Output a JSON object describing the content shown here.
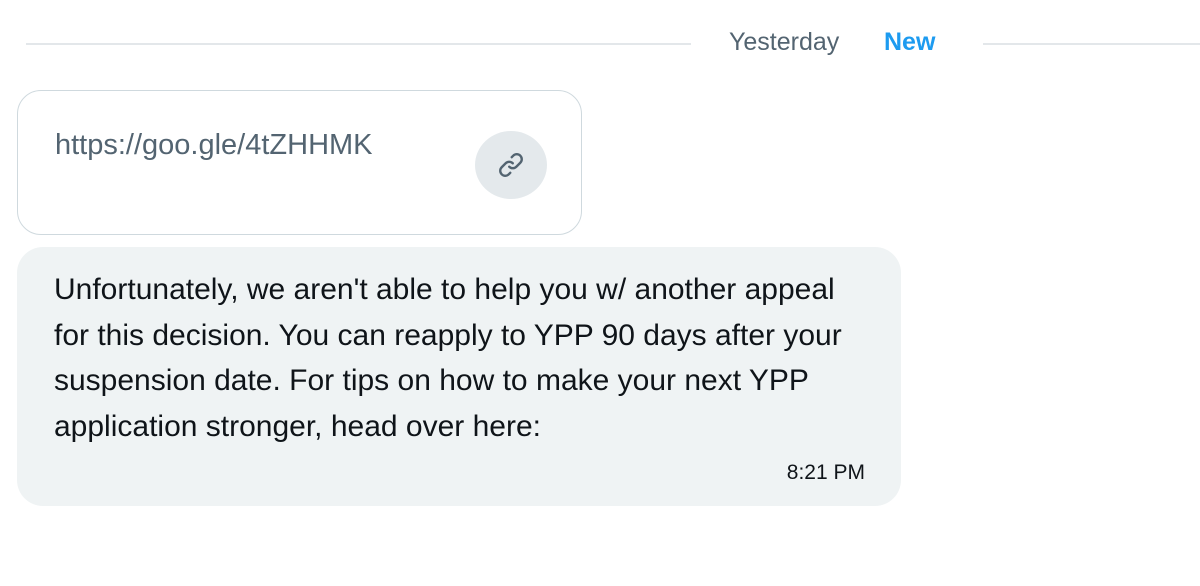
{
  "date_divider": {
    "label": "Yesterday",
    "badge": "New"
  },
  "link_card": {
    "url": "https://goo.gle/4tZHHMK",
    "icon": "link-icon"
  },
  "message": {
    "text": "Unfortunately, we aren't able to help you w/ another appeal for this decision. You can reapply to YPP 90 days after your suspension date. For tips on how to make your next YPP application stronger, head over here:",
    "time": "8:21 PM"
  },
  "colors": {
    "accent": "#1d9bf0",
    "muted_text": "#536471",
    "bubble_bg": "#eff3f4",
    "divider": "#e3e7ea"
  }
}
